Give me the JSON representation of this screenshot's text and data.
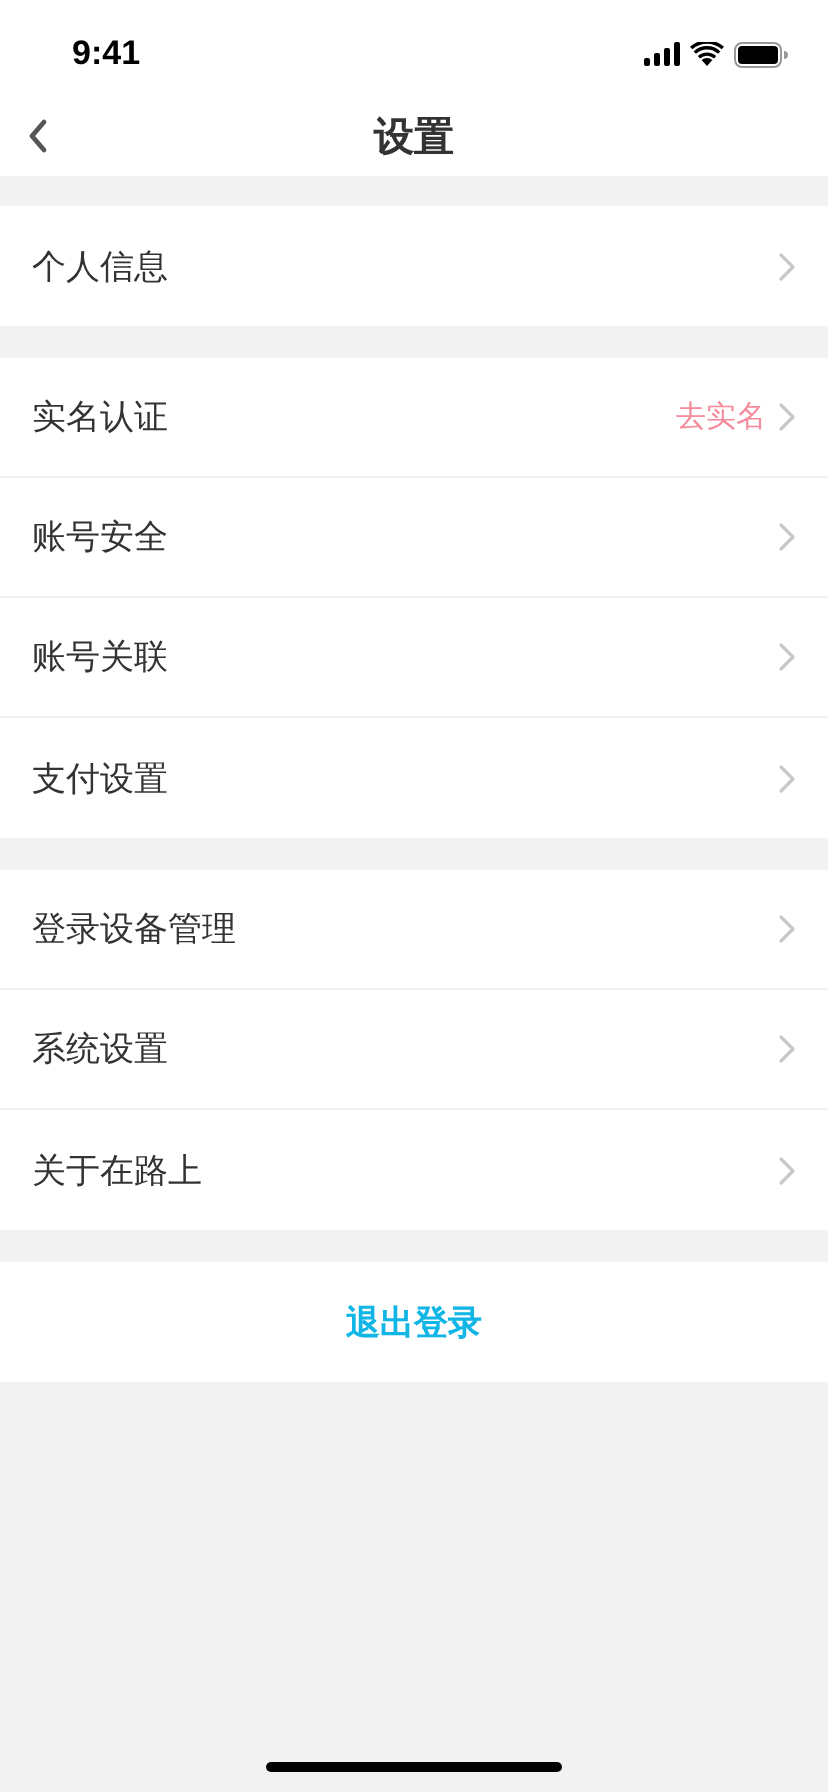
{
  "status_bar": {
    "time": "9:41"
  },
  "nav": {
    "title": "设置"
  },
  "groups": [
    {
      "items": [
        {
          "label": "个人信息"
        }
      ]
    },
    {
      "items": [
        {
          "label": "实名认证",
          "value": "去实名"
        },
        {
          "label": "账号安全"
        },
        {
          "label": "账号关联"
        },
        {
          "label": "支付设置"
        }
      ]
    },
    {
      "items": [
        {
          "label": "登录设备管理"
        },
        {
          "label": "系统设置"
        },
        {
          "label": "关于在路上"
        }
      ]
    }
  ],
  "logout": "退出登录"
}
